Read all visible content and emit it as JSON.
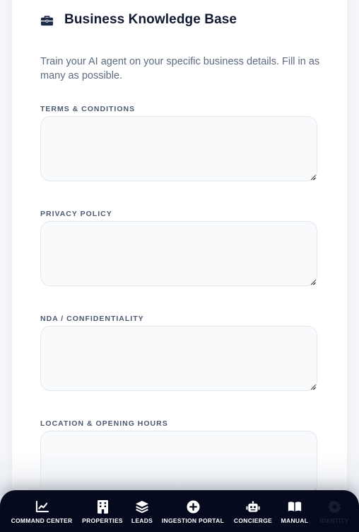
{
  "section": {
    "title": "Business Knowledge Base",
    "icon": "briefcase-icon",
    "intro": "Train your AI agent on your specific business details. Fill in as many as possible."
  },
  "fields": [
    {
      "label": "Terms & Conditions",
      "value": "",
      "placeholder": ""
    },
    {
      "label": "Privacy Policy",
      "value": "",
      "placeholder": ""
    },
    {
      "label": "NDA / Confidentiality",
      "value": "",
      "placeholder": ""
    },
    {
      "label": "Location & Opening Hours",
      "value": "",
      "placeholder": ""
    }
  ],
  "nav": {
    "items": [
      {
        "label": "Command Center",
        "icon": "chart-line-icon"
      },
      {
        "label": "Properties",
        "icon": "building-icon"
      },
      {
        "label": "Leads",
        "icon": "layers-icon"
      },
      {
        "label": "Ingestion Portal",
        "icon": "plus-circle-icon"
      },
      {
        "label": "Concierge",
        "icon": "robot-icon"
      },
      {
        "label": "Manual",
        "icon": "book-icon"
      },
      {
        "label": "Identity",
        "icon": "gear-icon"
      }
    ]
  },
  "colors": {
    "nav_background": "#050a1f",
    "title": "#111a33",
    "label": "#4b5a70",
    "field_background": "#f8fafc",
    "field_border": "#e3e8ef"
  }
}
